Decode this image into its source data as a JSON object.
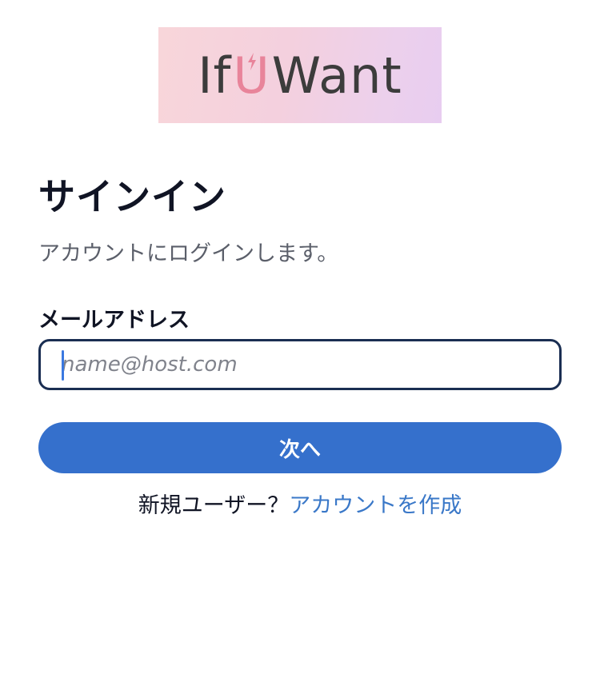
{
  "logo": {
    "text_before": "If",
    "text_u": "U",
    "text_after": "Want"
  },
  "page": {
    "title": "サインイン",
    "subtitle": "アカウントにログインします。"
  },
  "email_field": {
    "label": "メールアドレス",
    "placeholder": "name@host.com",
    "value": ""
  },
  "next_button": {
    "label": "次へ"
  },
  "signup": {
    "prompt": "新規ユーザー？",
    "link_label": "アカウントを作成"
  },
  "colors": {
    "primary_button": "#3570cc",
    "link": "#3a78c8",
    "input_border": "#1a2e52",
    "logo_u": "#e8849a"
  }
}
